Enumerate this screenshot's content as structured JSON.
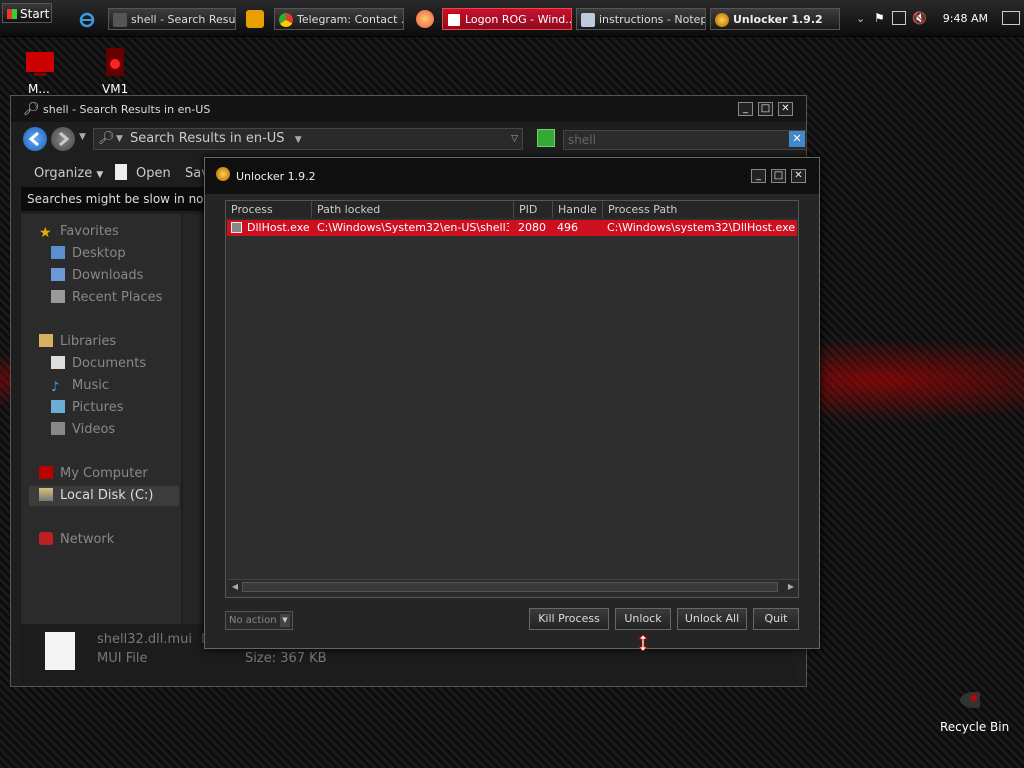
{
  "taskbar": {
    "start_label": "Start",
    "items": [
      {
        "label": "shell - Search Resu..."
      },
      {
        "label": "Telegram: Contact ..."
      },
      {
        "label": "Logon ROG - Wind..."
      },
      {
        "label": "instructions - Notep..."
      },
      {
        "label": "Unlocker 1.9.2"
      }
    ],
    "clock": "9:48 AM"
  },
  "desktop": {
    "icons": [
      {
        "label": "M..."
      },
      {
        "label": "VM1"
      }
    ],
    "recycle_bin_label": "Recycle Bin"
  },
  "explorer": {
    "title": "shell - Search Results in en-US",
    "address": "Search Results in en-US",
    "search_value": "shell",
    "toolbar": {
      "organize": "Organize",
      "open": "Open",
      "save": "Sav"
    },
    "info_bar": "Searches might be slow in nor",
    "nav": {
      "favorites": "Favorites",
      "desktop": "Desktop",
      "downloads": "Downloads",
      "recent_places": "Recent Places",
      "libraries": "Libraries",
      "documents": "Documents",
      "music": "Music",
      "pictures": "Pictures",
      "videos": "Videos",
      "my_computer": "My Computer",
      "local_disk": "Local Disk (C:)",
      "network": "Network"
    },
    "details": {
      "file_name": "shell32.dll.mui",
      "file_name_suffix": "Da",
      "file_type": "MUI File",
      "size": "Size: 367 KB"
    }
  },
  "unlocker": {
    "title": "Unlocker 1.9.2",
    "columns": [
      "Process",
      "Path locked",
      "PID",
      "Handle",
      "Process Path"
    ],
    "rows": [
      {
        "process": "DllHost.exe",
        "path_locked": "C:\\Windows\\System32\\en-US\\shell3...",
        "pid": "2080",
        "handle": "496",
        "process_path": "C:\\Windows\\system32\\DllHost.exe"
      }
    ],
    "action_select": "No action",
    "buttons": {
      "kill": "Kill Process",
      "unlock": "Unlock",
      "unlock_all": "Unlock All",
      "quit": "Quit"
    }
  }
}
